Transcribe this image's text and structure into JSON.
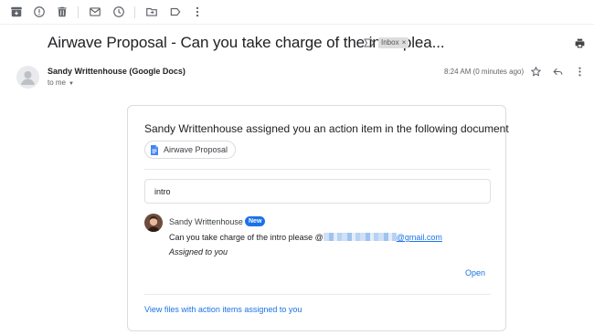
{
  "toolbar": {
    "icons": [
      "archive-icon",
      "report-spam-icon",
      "delete-icon",
      "mark-unread-icon",
      "snooze-icon",
      "move-to-icon",
      "label-icon",
      "more-vert-icon"
    ]
  },
  "message": {
    "subject": "Airwave Proposal - Can you take charge of the intro plea...",
    "inbox_label": "Inbox",
    "inbox_remove": "×",
    "sender": "Sandy Writtenhouse (Google Docs)",
    "recipient": "to me",
    "time": "8:24 AM (0 minutes ago)"
  },
  "card": {
    "heading": "Sandy Writtenhouse assigned you an action item in the following document",
    "document_name": "Airwave Proposal",
    "quoted_text": "intro",
    "comment": {
      "author": "Sandy Writtenhouse",
      "badge": "New",
      "text_prefix": "Can you take charge of the intro please @",
      "email_suffix": "@gmail.com",
      "assigned_note": "Assigned to you"
    },
    "open_link": "Open",
    "view_link": "View files with action items assigned to you"
  },
  "colors": {
    "link": "#1a73e8",
    "badge": "#1a73e8",
    "docs_icon": "#4285f4"
  }
}
